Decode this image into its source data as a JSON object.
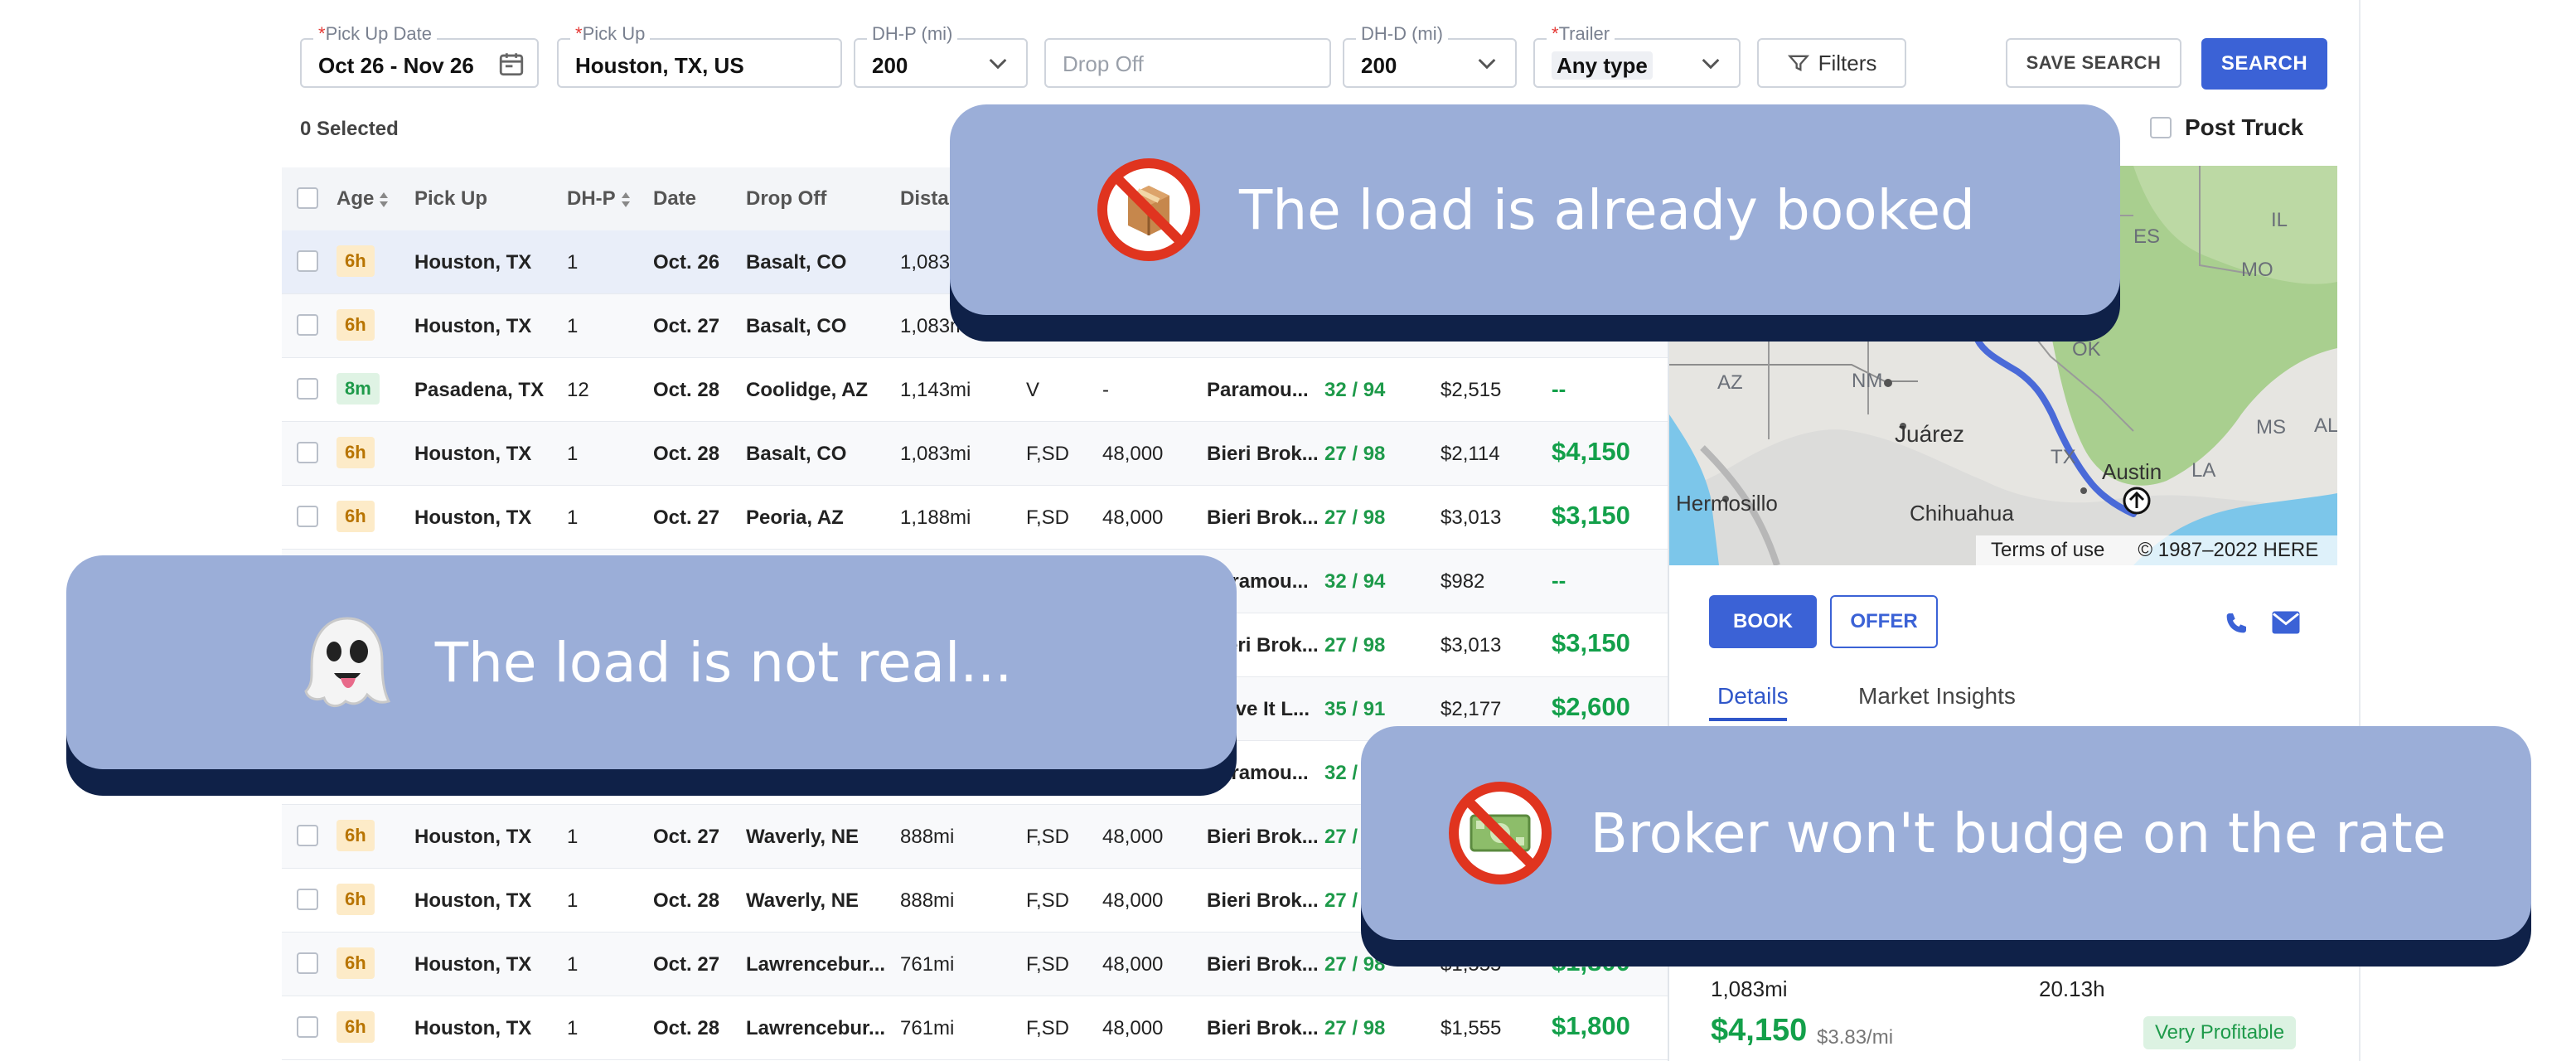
{
  "search": {
    "pickup_date": {
      "label": "Pick Up Date",
      "value": "Oct 26 - Nov 26"
    },
    "pickup": {
      "label": "Pick Up",
      "value": "Houston, TX, US"
    },
    "dh_p": {
      "label": "DH-P (mi)",
      "value": "200"
    },
    "dropoff": {
      "placeholder": "Drop Off"
    },
    "dh_d": {
      "label": "DH-D (mi)",
      "value": "200"
    },
    "trailer": {
      "label": "Trailer",
      "value": "Any type"
    },
    "filters_label": "Filters",
    "save_label": "SAVE SEARCH",
    "search_label": "SEARCH",
    "required_mark": "*"
  },
  "selected_count": "0 Selected",
  "post_truck_label": "Post Truck",
  "table": {
    "headers": [
      "Age",
      "Pick Up",
      "DH-P",
      "Date",
      "Drop Off",
      "Distance"
    ],
    "header_visible": [
      "Age",
      "Pick Up",
      "DH-P",
      "Date",
      "Drop Off",
      "Distan"
    ],
    "rows": [
      {
        "age": "6h",
        "pickup": "Houston, TX",
        "dhp": "1",
        "date": "Oct. 26",
        "dropoff": "Basalt, CO",
        "dist": "1,083mi",
        "eq": "",
        "weight": "",
        "broker": "",
        "rating": "",
        "est": "",
        "rate": ""
      },
      {
        "age": "6h",
        "pickup": "Houston, TX",
        "dhp": "1",
        "date": "Oct. 27",
        "dropoff": "Basalt, CO",
        "dist": "1,083mi",
        "eq": "",
        "weight": "",
        "broker": "",
        "rating": "",
        "est": "",
        "rate": ""
      },
      {
        "age": "8m",
        "pickup": "Pasadena, TX",
        "dhp": "12",
        "date": "Oct. 28",
        "dropoff": "Coolidge, AZ",
        "dist": "1,143mi",
        "eq": "V",
        "weight": "-",
        "broker": "Paramou...",
        "rating": "32 / 94",
        "est": "$2,515",
        "rate": "--"
      },
      {
        "age": "6h",
        "pickup": "Houston, TX",
        "dhp": "1",
        "date": "Oct. 28",
        "dropoff": "Basalt, CO",
        "dist": "1,083mi",
        "eq": "F,SD",
        "weight": "48,000",
        "broker": "Bieri Brok...",
        "rating": "27 / 98",
        "est": "$2,114",
        "rate": "$4,150"
      },
      {
        "age": "6h",
        "pickup": "Houston, TX",
        "dhp": "1",
        "date": "Oct. 27",
        "dropoff": "Peoria, AZ",
        "dist": "1,188mi",
        "eq": "F,SD",
        "weight": "48,000",
        "broker": "Bieri Brok...",
        "rating": "27 / 98",
        "est": "$3,013",
        "rate": "$3,150"
      },
      {
        "age": "",
        "pickup": "",
        "dhp": "",
        "date": "",
        "dropoff": "",
        "dist": "",
        "eq": "",
        "weight": "",
        "broker": "Paramou...",
        "rating": "32 / 94",
        "est": "$982",
        "rate": "--"
      },
      {
        "age": "",
        "pickup": "",
        "dhp": "",
        "date": "",
        "dropoff": "",
        "dist": "",
        "eq": "",
        "weight": "",
        "broker": "Bieri Brok...",
        "rating": "27 / 98",
        "est": "$3,013",
        "rate": "$3,150"
      },
      {
        "age": "",
        "pickup": "",
        "dhp": "",
        "date": "",
        "dropoff": "",
        "dist": "",
        "eq": "",
        "weight": "",
        "broker": "Move It L...",
        "rating": "35 / 91",
        "est": "$2,177",
        "rate": "$2,600"
      },
      {
        "age": "",
        "pickup": "",
        "dhp": "",
        "date": "",
        "dropoff": "",
        "dist": "",
        "eq": "",
        "weight": "",
        "broker": "Paramou...",
        "rating": "32 / 94",
        "est": "",
        "rate": ""
      },
      {
        "age": "6h",
        "pickup": "Houston, TX",
        "dhp": "1",
        "date": "Oct. 27",
        "dropoff": "Waverly, NE",
        "dist": "888mi",
        "eq": "F,SD",
        "weight": "48,000",
        "broker": "Bieri Brok...",
        "rating": "27 /",
        "est": "",
        "rate": ""
      },
      {
        "age": "6h",
        "pickup": "Houston, TX",
        "dhp": "1",
        "date": "Oct. 28",
        "dropoff": "Waverly, NE",
        "dist": "888mi",
        "eq": "F,SD",
        "weight": "48,000",
        "broker": "Bieri Brok...",
        "rating": "27 /",
        "est": "",
        "rate": ""
      },
      {
        "age": "6h",
        "pickup": "Houston, TX",
        "dhp": "1",
        "date": "Oct. 27",
        "dropoff": "Lawrencebur...",
        "dist": "761mi",
        "eq": "F,SD",
        "weight": "48,000",
        "broker": "Bieri Brok...",
        "rating": "27 / 98",
        "est": "$1,555",
        "rate": "$1,800"
      },
      {
        "age": "6h",
        "pickup": "Houston, TX",
        "dhp": "1",
        "date": "Oct. 28",
        "dropoff": "Lawrencebur...",
        "dist": "761mi",
        "eq": "F,SD",
        "weight": "48,000",
        "broker": "Bieri Brok...",
        "rating": "27 / 98",
        "est": "$1,555",
        "rate": "$1,800"
      }
    ]
  },
  "map": {
    "states": [
      "IL",
      "MO",
      "OK",
      "AZ",
      "NM",
      "TX",
      "MS",
      "AL",
      "LA",
      "ES"
    ],
    "cities": [
      "Juárez",
      "Hermosillo",
      "Chihuahua",
      "Austin"
    ],
    "terms": "Terms of use",
    "copyright": "© 1987–2022 HERE"
  },
  "details": {
    "book_label": "BOOK",
    "offer_label": "OFFER",
    "tabs": [
      "Details",
      "Market Insights"
    ],
    "distance_value": "1,083mi",
    "drive_time_value": "20.13h",
    "rate": "$4,150",
    "per_mile": "$3.83/mi",
    "profit_badge": "Very Profitable"
  },
  "callouts": [
    {
      "text": "The load is already booked",
      "icon": "box-prohibited-icon"
    },
    {
      "text": "The load is not real...",
      "icon": "ghost-icon"
    },
    {
      "text": "Broker won't budge on the rate",
      "icon": "money-prohibited-icon"
    }
  ],
  "colors": {
    "primary": "#3b62d6",
    "callout": "#9baed8",
    "callout_shadow": "#0f2148",
    "rate_green": "#13a04a",
    "age_hours": "#fdebc8",
    "age_minutes": "#dff3e4"
  }
}
